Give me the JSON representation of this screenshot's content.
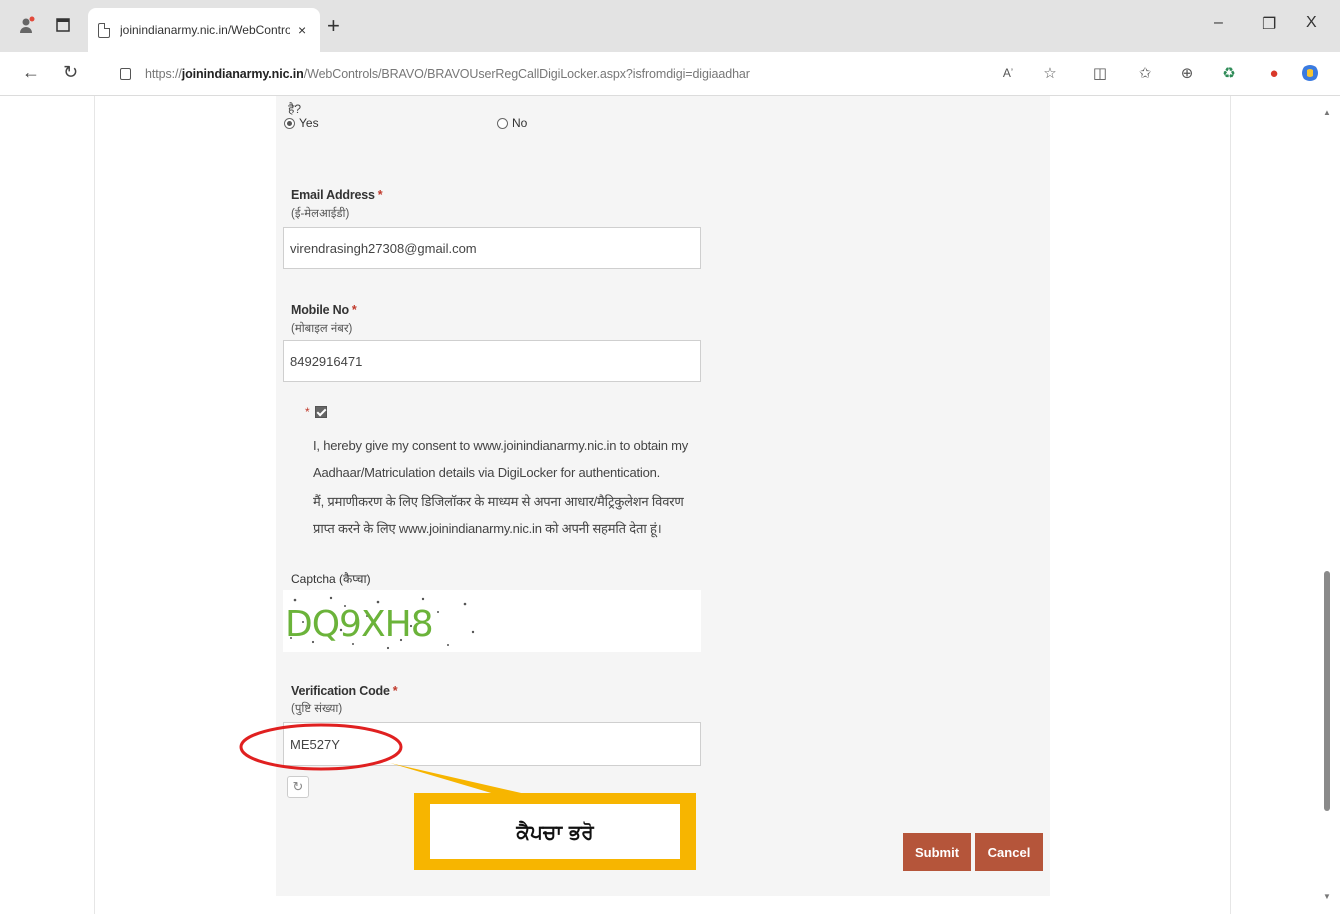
{
  "browser": {
    "tab_title": "joinindianarmy.nic.in/WebContro",
    "tab_close": "×",
    "new_tab": "+",
    "minimize": "–",
    "restore": "❐",
    "close": "X",
    "url_prefix": "https://",
    "url_domain": "joinindianarmy.nic.in",
    "url_path": "/WebControls/BRAVO/BRAVOUserRegCallDigiLocker.aspx?isfromdigi=digiaadhar"
  },
  "form": {
    "hindi_fragment": "है?",
    "radio_yes": "Yes",
    "radio_no": "No",
    "email": {
      "label": "Email Address",
      "required": "*",
      "hindi": "(ई-मेलआईडी)",
      "value": "virendrasingh27308@gmail.com"
    },
    "mobile": {
      "label": "Mobile No",
      "required": "*",
      "hindi": "(मोबाइल नंबर)",
      "value": "8492916471"
    },
    "consent": {
      "required": "*",
      "line1": "I, hereby give my consent to www.joinindianarmy.nic.in to obtain my",
      "line2": "Aadhaar/Matriculation details via DigiLocker for authentication.",
      "line3": "मैं, प्रमाणीकरण के लिए डिजिलॉकर के माध्यम से अपना आधार/मैट्रिकुलेशन विवरण",
      "line4": "प्राप्त करने के लिए www.joinindianarmy.nic.in को अपनी सहमति देता हूं।"
    },
    "captcha": {
      "label": "Captcha (कैप्चा)",
      "text": "DQ9XH8"
    },
    "verification": {
      "label": "Verification Code",
      "required": "*",
      "hindi": "(पुष्टि संख्या)",
      "value": "ME527Y"
    },
    "submit_label": "Submit",
    "cancel_label": "Cancel"
  },
  "annotation": {
    "text": "ਕੈਪਚਾ ਭਰੋ",
    "box_color": "#f7b500",
    "circle_color": "#e02020"
  },
  "colors": {
    "button": "#b5553a",
    "required": "#c0392b"
  }
}
